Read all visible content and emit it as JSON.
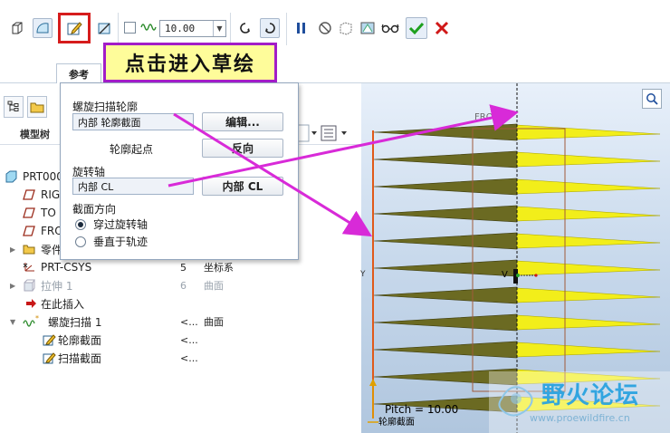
{
  "toolbar": {
    "pitch_value": "10.00"
  },
  "ref_tab_label": "参考",
  "callout_text": "点击进入草绘",
  "left_panel": {
    "model_tree_label": "模型树"
  },
  "tree": [
    {
      "label": "PRT000"
    },
    {
      "label": "RIG"
    },
    {
      "label": "TO"
    },
    {
      "label": "FRO"
    },
    {
      "label": "零件"
    },
    {
      "label": "PRT-CSYS",
      "id": "5",
      "type": "坐标系"
    },
    {
      "label": "拉伸 1",
      "id": "6",
      "type": "曲面"
    },
    {
      "label": "在此插入"
    },
    {
      "label": "螺旋扫描 1",
      "id": "<...",
      "type": "曲面"
    },
    {
      "label": "轮廓截面",
      "id": "<..."
    },
    {
      "label": "扫描截面",
      "id": "<..."
    }
  ],
  "popup": {
    "profile_label": "螺旋扫描轮廓",
    "profile_value": "内部 轮廓截面",
    "edit_button": "编辑...",
    "start_point_label": "轮廓起点",
    "reverse_button": "反向",
    "axis_label": "旋转轴",
    "axis_value": "内部 CL",
    "axis_button": "内部 CL",
    "section_dir_label": "截面方向",
    "radio_through": "穿过旋转轴",
    "radio_normal": "垂直于轨迹"
  },
  "viewport": {
    "front_label": "FRONT",
    "v_label": "V",
    "pitch_text": "Pitch = 10.00",
    "section_label": "轮廓截面",
    "y_tick": "Y"
  },
  "watermark": {
    "title": "野火论坛",
    "url": "www.proewildfire.cn"
  }
}
